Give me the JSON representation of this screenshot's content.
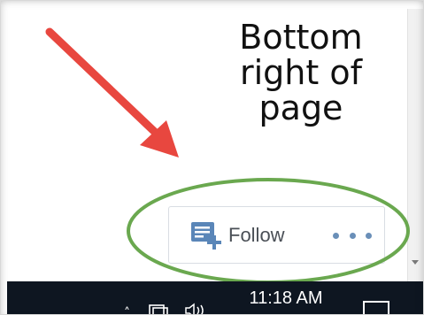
{
  "callout": {
    "lines": [
      "Bottom",
      "right of",
      "page"
    ]
  },
  "follow_bar": {
    "follow_label": "Follow",
    "follow_icon": "follow-document-icon",
    "more_icon": "more-options-icon"
  },
  "taskbar": {
    "time": "11:18 AM",
    "tray_icons": [
      "tray-chevron-up-icon",
      "network-icon",
      "volume-icon",
      "notification-icon"
    ]
  },
  "colors": {
    "arrow": "#e8473f",
    "highlight_ellipse": "#6aa84f",
    "follow_icon": "#5a86b8",
    "more_dots": "#6a8fb8",
    "taskbar": "#0e1621"
  }
}
